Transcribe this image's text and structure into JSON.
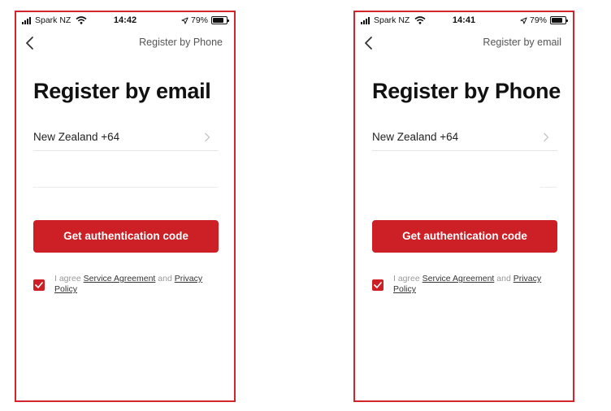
{
  "screens": [
    {
      "status_bar": {
        "carrier": "Spark NZ",
        "time": "14:42",
        "battery": "79%"
      },
      "nav": {
        "switch_link": "Register by Phone"
      },
      "title": "Register by email",
      "country": "New Zealand +64",
      "input_placeholder": "",
      "button": "Get authentication code",
      "agreement": {
        "prefix": "I agree",
        "service_link": "Service Agreement",
        "and": "and",
        "privacy_link": "Privacy Policy",
        "checked": true
      }
    },
    {
      "status_bar": {
        "carrier": "Spark NZ",
        "time": "14:41",
        "battery": "79%"
      },
      "nav": {
        "switch_link": "Register by email"
      },
      "title": "Register by Phone",
      "country": "New Zealand +64",
      "input_placeholder": "",
      "button": "Get authentication code",
      "agreement": {
        "prefix": "I agree",
        "service_link": "Service Agreement",
        "and": "and",
        "privacy_link": "Privacy Policy",
        "checked": true
      }
    }
  ],
  "colors": {
    "accent": "#cc1f26",
    "frame": "#d3232b"
  },
  "icons": [
    "signal-icon",
    "wifi-icon",
    "location-arrow-icon",
    "battery-icon",
    "back-chevron-icon",
    "chevron-right-icon",
    "checkmark-icon"
  ]
}
